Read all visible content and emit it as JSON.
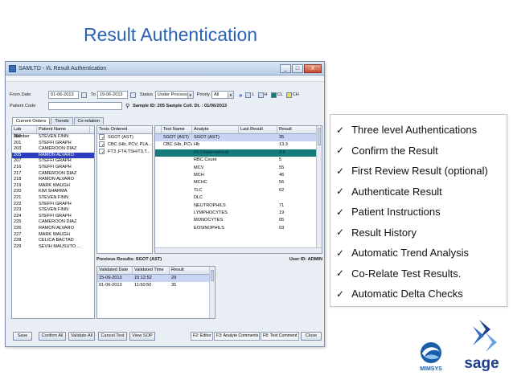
{
  "slide": {
    "title": "Result Authentication"
  },
  "window": {
    "title": "SAMLTD - I/L Result Authentication",
    "title_suffix": "(Blurred)",
    "btn_min": "_",
    "btn_max": "□",
    "btn_close": "X"
  },
  "filters": {
    "from_date_label": "From Date",
    "from_date_value": "01-06-2013",
    "to_label": "To",
    "to_value": "19-06-2013",
    "status_label": "Status",
    "status_value": "Under Process",
    "priority_label": "Priorty",
    "priority_value": "All",
    "nav_arrows": "»",
    "legend": [
      {
        "label": "L",
        "color": "#cfe0f7"
      },
      {
        "label": "H",
        "color": "#cfe0f7"
      },
      {
        "label": "CL",
        "color": "#157c7a"
      },
      {
        "label": "CH",
        "color": "#e9dc5b"
      }
    ],
    "patient_code_label": "Patient Code",
    "patient_code_value": "",
    "sample_info": "Sample ID: 205 Sample Coll. Dt. : 01/06/2013"
  },
  "tabs": [
    "Current Orders",
    "Trends",
    "Co-relation"
  ],
  "patients": {
    "columns": [
      "Lab Number",
      "Patient Name"
    ],
    "rows": [
      [
        "200",
        "STEVEN  FINN"
      ],
      [
        "201",
        "STEFFI  GRAPH"
      ],
      [
        "203",
        "CAMEROON  DIAZ"
      ],
      [
        "205",
        "RAMON  ALVARO"
      ],
      [
        "207",
        "STEFFI  GRAPH"
      ],
      [
        "216",
        "STEFFI  GRAPH"
      ],
      [
        "217",
        "CAMEROON  DIAZ"
      ],
      [
        "218",
        "RAMON  ALVARO"
      ],
      [
        "219",
        "MARK  WAUGH"
      ],
      [
        "220",
        "KIM  SHARMA"
      ],
      [
        "221",
        "STEVEN  FINN"
      ],
      [
        "222",
        "STEFFI  GRAPH"
      ],
      [
        "223",
        "STEVEN  FINN"
      ],
      [
        "224",
        "STEFFI  GRAPH"
      ],
      [
        "225",
        "CAMEROON  DIAZ"
      ],
      [
        "226",
        "RAMON  ALVARO"
      ],
      [
        "227",
        "MARK  WAUGH"
      ],
      [
        "228",
        "CELICA  BACTAD"
      ],
      [
        "229",
        "SEVIH  MAUSUTO ..."
      ]
    ],
    "selected_index": 3
  },
  "tests_ordered": {
    "header": "Tests Ordered",
    "items": [
      "SGOT (AST)",
      "CBC (Hb, PCV, PLA...",
      "FT3 ,FT4,TSH/T3,T..."
    ]
  },
  "results": {
    "columns": [
      "Test Name",
      "Analyte",
      "Last Result",
      "Result"
    ],
    "rows": [
      [
        "SGOT (AST)",
        "SGOT (AST)",
        "",
        "35"
      ],
      [
        "CBC (Hb, PCV, P...",
        "Hb",
        "",
        "13.3"
      ],
      [
        "",
        "PCV/Haematocrit",
        "",
        "3.9"
      ],
      [
        "",
        "RBC Count",
        "",
        "5"
      ],
      [
        "",
        "MCV",
        "",
        "55"
      ],
      [
        "",
        "MCH",
        "",
        "46"
      ],
      [
        "",
        "MCHC",
        "",
        "56"
      ],
      [
        "",
        "TLC",
        "",
        "62"
      ],
      [
        "",
        "DLC",
        "",
        ""
      ],
      [
        "",
        "NEUTROPHILS",
        "",
        "71"
      ],
      [
        "",
        "LYMPHOCYTES",
        "",
        "19"
      ],
      [
        "",
        "MONOCYTES",
        "",
        "05"
      ],
      [
        "",
        "EOSINOPHILS",
        "",
        "03"
      ]
    ]
  },
  "previous_results": {
    "header": "Previous Results: SGOT (AST)",
    "user_id": "User ID: ADMIN",
    "columns": [
      "Validated Date",
      "Validated Time",
      "Result"
    ],
    "rows": [
      [
        "15-06-2013",
        "15:12:52",
        "29"
      ],
      [
        "01-06-2013",
        "11:50:50",
        "35"
      ]
    ]
  },
  "buttons": {
    "save": "Save",
    "confirm_all": "Confirm All",
    "validate_all": "Validate All",
    "cancel_test": "Cancel Test",
    "view_sop": "View SOP",
    "close": "Close"
  },
  "shortcuts": [
    "F2: Editor",
    "F3: Analyte Comments",
    "F8: Test Comment"
  ],
  "features": [
    "Three level Authentications",
    "Confirm the Result",
    "First Review Result (optional)",
    "Authenticate Result",
    "Patient Instructions",
    "Result History",
    "Automatic Trend Analysis",
    "Co-Relate Test Results.",
    "Automatic Delta Checks"
  ],
  "logos": {
    "mimsys": "MIMSYS",
    "sage": "sage"
  },
  "colors": {
    "title": "#2a62b6",
    "selection": "#2b3fbf",
    "critical_low": "#157c7a"
  }
}
